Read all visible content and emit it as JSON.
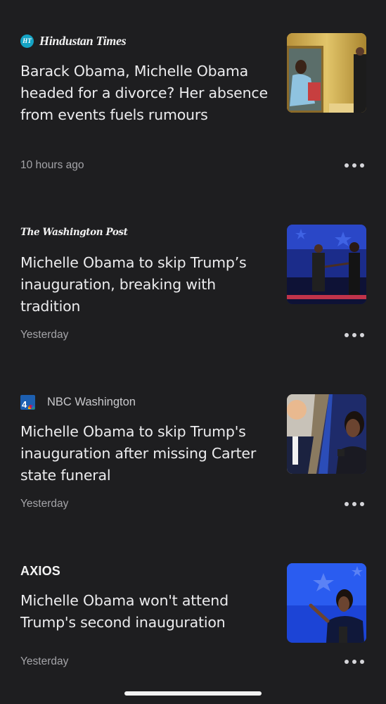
{
  "articles": [
    {
      "source": "Hindustan Times",
      "source_badge": "HT",
      "headline": "Barack Obama, Michelle Obama headed for a divorce? Her absence from events fuels rumours",
      "time": "10 hours ago"
    },
    {
      "source": "The Washington Post",
      "headline": "Michelle Obama to skip Trump’s inauguration, breaking with tradition",
      "time": "Yesterday"
    },
    {
      "source": "NBC Washington",
      "source_badge": "4",
      "headline": "Michelle Obama to skip Trump's inauguration after missing Carter state funeral",
      "time": "Yesterday"
    },
    {
      "source": "AXIOS",
      "headline": "Michelle Obama won't attend Trump's second inauguration",
      "time": "Yesterday"
    }
  ],
  "colors": {
    "background": "#1e1e20",
    "headline": "#ececee",
    "meta": "#a4a4a8",
    "ht_accent": "#15a3c4",
    "nbc_accent": "#1d5fb0"
  },
  "icons": [
    "more-options-icon",
    "ht-logo-icon",
    "nbc-logo-icon"
  ]
}
